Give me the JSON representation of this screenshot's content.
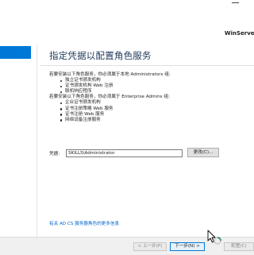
{
  "window": {
    "server_name": "WinServer"
  },
  "page": {
    "title": "指定凭据以配置角色服务",
    "local_admin_intro": "若要安装以下角色服务，你必须属于本地 Administrators 组:",
    "local_admin_services": [
      "独立证书颁发机构",
      "证书颁发机构 Web 注册",
      "联机响应程序"
    ],
    "enterprise_admin_intro": "若要安装以下角色服务，你必须属于 Enterprise Admins 组:",
    "enterprise_admin_services": [
      "企业证书颁发机构",
      "证书注册策略 Web 服务",
      "证书注册 Web 服务",
      "网络设备注册服务"
    ],
    "credentials_label": "凭据:",
    "credentials_value": "SKILLS\\Administrator",
    "change_button": "更改(C)...",
    "more_info_link": "有关 AD CS 服务器角色的更多信息"
  },
  "footer": {
    "prev_button": "< 上一步(P)",
    "next_button": "下一步(N) >",
    "configure_button": "配置(C)"
  },
  "colors": {
    "accent": "#0078d7",
    "title": "#1e395b",
    "link": "#0066cc",
    "footer_bg": "#f0f0f0"
  },
  "icons": {
    "cursor": "mouse-pointer-busy-icon"
  }
}
